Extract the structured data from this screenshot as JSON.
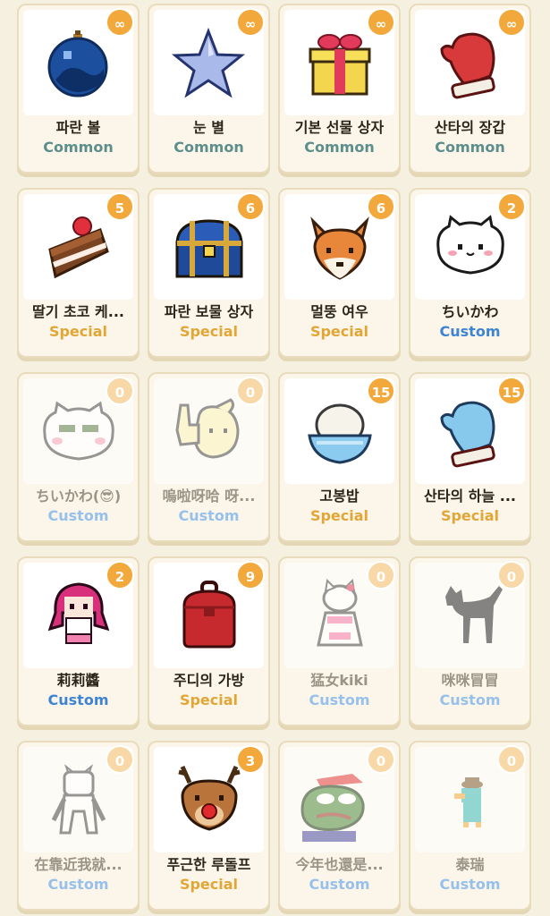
{
  "items": [
    {
      "name": "파란 볼",
      "rarity": "Common",
      "count": "∞",
      "icon": "blue-ornament-icon"
    },
    {
      "name": "눈 별",
      "rarity": "Common",
      "count": "∞",
      "icon": "snow-star-icon"
    },
    {
      "name": "기본 선물 상자",
      "rarity": "Common",
      "count": "∞",
      "icon": "gift-box-icon"
    },
    {
      "name": "산타의 장갑",
      "rarity": "Common",
      "count": "∞",
      "icon": "red-mitten-icon"
    },
    {
      "name": "딸기 초코 케...",
      "rarity": "Special",
      "count": "5",
      "icon": "strawberry-cake-icon"
    },
    {
      "name": "파란 보물 상자",
      "rarity": "Special",
      "count": "6",
      "icon": "treasure-chest-icon"
    },
    {
      "name": "멀뚱 여우",
      "rarity": "Special",
      "count": "6",
      "icon": "fox-icon"
    },
    {
      "name": "ちいかわ",
      "rarity": "Custom",
      "count": "2",
      "icon": "chiikawa-icon"
    },
    {
      "name": "ちいかわ(😎)",
      "rarity": "Custom",
      "count": "0",
      "icon": "chiikawa-sunglasses-icon"
    },
    {
      "name": "嗚啦呀哈 呀...",
      "rarity": "Custom",
      "count": "0",
      "icon": "thumbs-up-bunny-icon"
    },
    {
      "name": "고봉밥",
      "rarity": "Special",
      "count": "15",
      "icon": "rice-bowl-icon"
    },
    {
      "name": "산타의 하늘 ...",
      "rarity": "Special",
      "count": "15",
      "icon": "blue-mitten-icon"
    },
    {
      "name": "莉莉醬",
      "rarity": "Custom",
      "count": "2",
      "icon": "pink-hair-girl-icon"
    },
    {
      "name": "주디의 가방",
      "rarity": "Special",
      "count": "9",
      "icon": "red-backpack-icon"
    },
    {
      "name": "猛女kiki",
      "rarity": "Custom",
      "count": "0",
      "icon": "kitty-icon"
    },
    {
      "name": "咪咪冒冒",
      "rarity": "Custom",
      "count": "0",
      "icon": "black-cat-icon"
    },
    {
      "name": "在靠近我就...",
      "rarity": "Custom",
      "count": "0",
      "icon": "white-cat-icon"
    },
    {
      "name": "푸근한 루돌프",
      "rarity": "Special",
      "count": "3",
      "icon": "reindeer-icon"
    },
    {
      "name": "今年也還是...",
      "rarity": "Custom",
      "count": "0",
      "icon": "sad-frog-icon"
    },
    {
      "name": "泰瑞",
      "rarity": "Custom",
      "count": "0",
      "icon": "platypus-icon"
    }
  ]
}
